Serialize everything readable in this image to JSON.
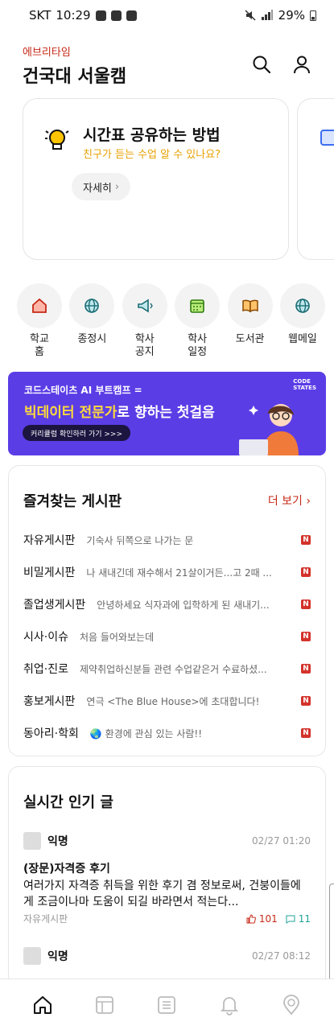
{
  "status_bar": {
    "carrier": "SKT",
    "time": "10:29",
    "battery": "29%"
  },
  "header": {
    "brand": "에브리타임",
    "school": "건국대 서울캠"
  },
  "guide_card": {
    "title": "시간표 공유하는 방법",
    "subtitle": "친구가 듣는 수업 알 수 있나요?",
    "button": "자세히"
  },
  "quick_links": [
    {
      "label": "학교\n홈",
      "icon": "home-icon"
    },
    {
      "label": "종정시",
      "icon": "globe-icon"
    },
    {
      "label": "학사\n공지",
      "icon": "megaphone-icon"
    },
    {
      "label": "학사\n일정",
      "icon": "calendar-icon"
    },
    {
      "label": "도서관",
      "icon": "book-icon"
    },
    {
      "label": "웹메일",
      "icon": "globe-icon"
    }
  ],
  "banner": {
    "top": "코드스테이츠 AI 부트캠프 =",
    "main_highlight": "빅데이터 전문가",
    "main_rest": "로 향하는 첫걸음",
    "cta": "커리큘럼 확인하러 가기 >>>",
    "logo_line1": "CODE",
    "logo_line2": "STATES"
  },
  "favorites": {
    "title": "즐겨찾는 게시판",
    "more": "더 보기",
    "boards": [
      {
        "name": "자유게시판",
        "preview": "기숙사 뒤쪽으로 나가는 문",
        "badge": "N"
      },
      {
        "name": "비밀게시판",
        "preview": "나 새내긴데 재수해서 21살이거든...고 2때 ...",
        "badge": "N"
      },
      {
        "name": "졸업생게시판",
        "preview": "안녕하세요 식자과에 입학하게 된 새내기...",
        "badge": "N"
      },
      {
        "name": "시사·이슈",
        "preview": "처음 들어와보는데",
        "badge": "N"
      },
      {
        "name": "취업·진로",
        "preview": "제약취업하신분들 관련 수업같은거 수료하셨...",
        "badge": "N"
      },
      {
        "name": "홍보게시판",
        "preview": "연극 <The Blue House>에 초대합니다!",
        "badge": "N"
      },
      {
        "name": "동아리·학회",
        "preview": "🌏 환경에 관심 있는 사람!!",
        "badge": "N"
      }
    ]
  },
  "hot_posts": {
    "title": "실시간 인기 글",
    "posts": [
      {
        "author": "익명",
        "time": "02/27 01:20",
        "title": "(장문)자격증 후기",
        "body": "여러가지 자격증 취득을 위한 후기 겸 정보로써, 건붕이들에게 조금이나마 도움이 되길 바라면서 적는다...",
        "board": "자유게시판",
        "likes": "101",
        "comments": "11"
      },
      {
        "author": "익명",
        "time": "02/27 08:12"
      }
    ]
  },
  "colors": {
    "accent": "#c62917",
    "banner": "#5b3de6",
    "highlight": "#ffdb3a",
    "comment": "#1fa39a"
  },
  "bottom_nav": [
    "home-icon",
    "timetable-icon",
    "list-icon",
    "bell-icon",
    "campus-pick-icon"
  ]
}
